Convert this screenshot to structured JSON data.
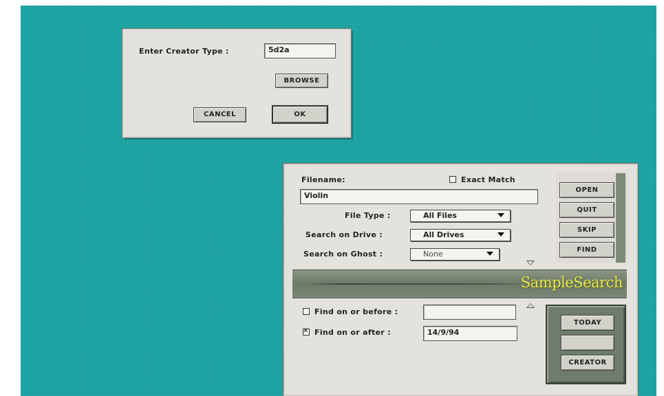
{
  "creator_dialog": {
    "prompt_label": "Enter Creator Type :",
    "creator_value": "5d2a",
    "browse_label": "BROWSE",
    "cancel_label": "CANCEL",
    "ok_label": "OK"
  },
  "search_window": {
    "filename_label": "Filename:",
    "exact_match_label": "Exact Match",
    "exact_match_checked": false,
    "filename_value": "Violin",
    "file_type_label": "File Type :",
    "file_type_value": "All Files",
    "drive_label": "Search on Drive :",
    "drive_value": "All Drives",
    "ghost_label": "Search on Ghost :",
    "ghost_value": "None",
    "buttons": {
      "open": "OPEN",
      "quit": "QUIT",
      "skip": "SKIP",
      "find": "FIND"
    },
    "banner_title": "SampleSearch",
    "find_before_label": "Find on or before :",
    "find_before_checked": false,
    "find_before_value": "",
    "find_after_label": "Find on or after :",
    "find_after_checked": true,
    "find_after_value": "14/9/94",
    "date_buttons": {
      "today": "TODAY",
      "blank": "",
      "creator": "CREATOR"
    }
  },
  "colors": {
    "desktop": "#1aa4a2",
    "dialog": "#e3e2dc",
    "banner_text": "#e9e84a",
    "date_panel": "#6f7b6c"
  }
}
